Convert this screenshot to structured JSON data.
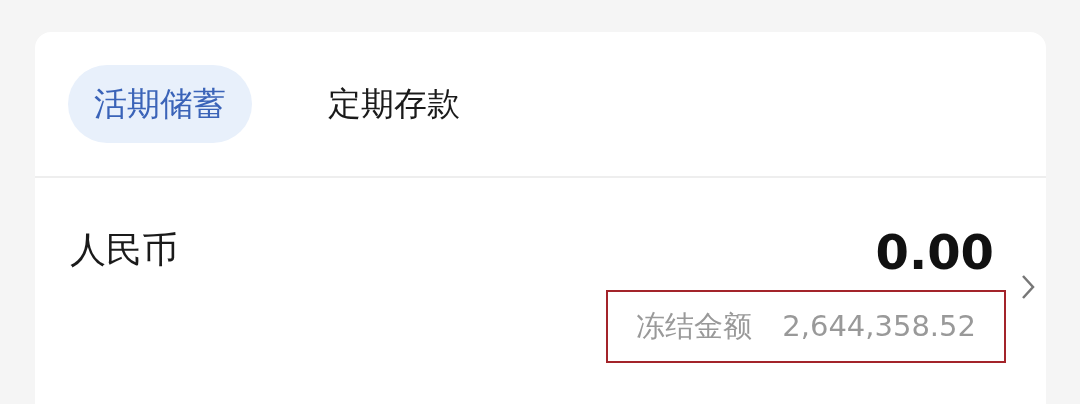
{
  "tabs": [
    {
      "label": "活期储蓄",
      "selected": true
    },
    {
      "label": "定期存款",
      "selected": false
    }
  ],
  "account": {
    "currency": "人民币",
    "balance": "0.00",
    "frozen_label": "冻结金额",
    "frozen_amount": "2,644,358.52",
    "highlighted": true
  }
}
